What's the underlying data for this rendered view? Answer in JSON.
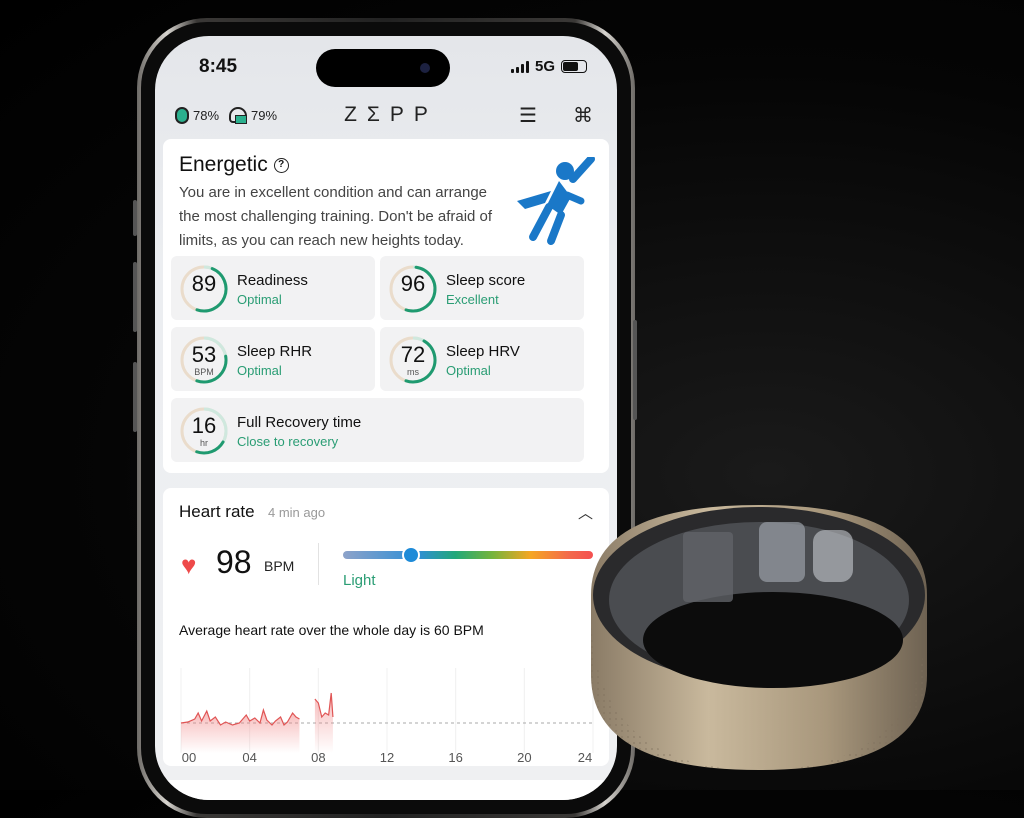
{
  "status_bar": {
    "time": "8:45",
    "network": "5G"
  },
  "header": {
    "watch_battery": "78%",
    "earbuds_battery": "79%",
    "logo": "ZΣPP",
    "icons": [
      "watch-icon",
      "earbuds-icon",
      "sort-icon",
      "apps-grid-icon"
    ]
  },
  "readiness_card": {
    "title": "Energetic",
    "description": "You are in excellent condition and can arrange the most challenging training. Don't be afraid of limits, as you can reach new heights today.",
    "tiles": [
      {
        "value": "89",
        "unit": "",
        "label": "Readiness",
        "status": "Optimal",
        "level": 0.89
      },
      {
        "value": "96",
        "unit": "",
        "label": "Sleep score",
        "status": "Excellent",
        "level": 0.96
      },
      {
        "value": "53",
        "unit": "BPM",
        "label": "Sleep RHR",
        "status": "Optimal",
        "level": 0.6
      },
      {
        "value": "72",
        "unit": "ms",
        "label": "Sleep HRV",
        "status": "Optimal",
        "level": 0.85
      },
      {
        "value": "16",
        "unit": "hr",
        "label": "Full Recovery time",
        "status": "Close to recovery",
        "level": 0.4
      }
    ]
  },
  "heart_rate_card": {
    "title": "Heart rate",
    "updated": "4 min ago",
    "value": "98",
    "unit": "BPM",
    "zone": "Light",
    "zone_position": 0.27,
    "average_text": "Average heart rate over the whole day is 60 BPM",
    "average_bpm": 60
  },
  "chart_data": {
    "type": "line",
    "x_ticks": [
      "00",
      "04",
      "08",
      "12",
      "16",
      "20",
      "24"
    ],
    "xlim": [
      0,
      24
    ],
    "reference_line": 60,
    "segments": [
      [
        [
          0,
          60
        ],
        [
          0.4,
          61
        ],
        [
          0.8,
          64
        ],
        [
          1,
          70
        ],
        [
          1.2,
          62
        ],
        [
          1.5,
          72
        ],
        [
          1.7,
          62
        ],
        [
          2,
          66
        ],
        [
          2.3,
          58
        ],
        [
          2.6,
          61
        ],
        [
          3,
          58
        ],
        [
          3.4,
          60
        ],
        [
          3.8,
          68
        ],
        [
          4,
          62
        ],
        [
          4.3,
          65
        ],
        [
          4.6,
          60
        ],
        [
          4.8,
          73
        ],
        [
          5,
          63
        ],
        [
          5.3,
          58
        ],
        [
          5.5,
          62
        ],
        [
          5.8,
          66
        ],
        [
          6,
          58
        ],
        [
          6.2,
          61
        ],
        [
          6.5,
          70
        ],
        [
          6.7,
          66
        ],
        [
          6.9,
          64
        ]
      ],
      [
        [
          7.8,
          84
        ],
        [
          8,
          80
        ],
        [
          8.2,
          66
        ],
        [
          8.4,
          70
        ],
        [
          8.6,
          68
        ],
        [
          8.75,
          90
        ],
        [
          8.85,
          66
        ]
      ]
    ]
  },
  "colors": {
    "accent_green": "#2a9d74",
    "heart_red": "#ee4a4a",
    "hero_blue": "#1a78c8"
  }
}
